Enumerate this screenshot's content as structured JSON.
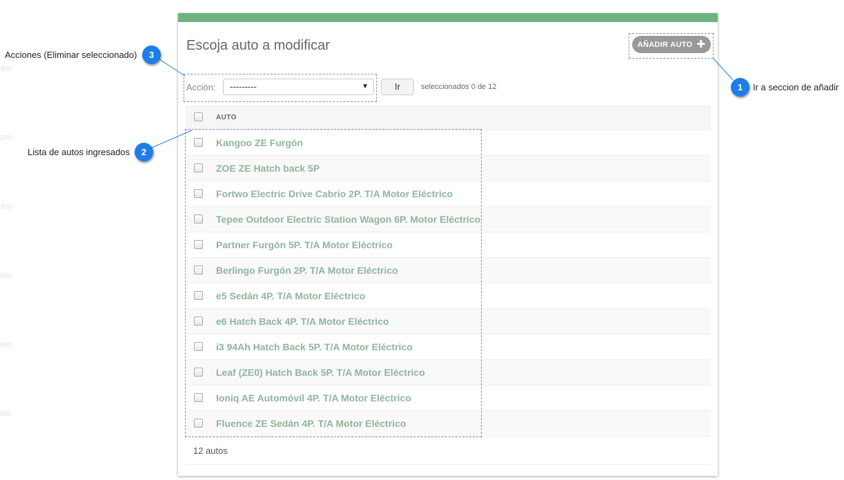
{
  "ruler": [
    "100",
    "200",
    "300",
    "400",
    "500",
    "600"
  ],
  "page": {
    "title": "Escoja auto a modificar",
    "add_button": "AÑADIR AUTO",
    "add_icon": "plus-icon"
  },
  "actions": {
    "label": "Acción:",
    "select_value": "---------",
    "go_button": "Ir",
    "selected_text": "seleccionados 0 de 12"
  },
  "table": {
    "column_header": "AUTO",
    "rows": [
      "Kangoo ZE Furgón",
      "ZOE ZE Hatch back 5P",
      "Fortwo Electric Drive Cabrio 2P. T/A Motor Eléctrico",
      "Tepee Outdoor Electric Station Wagon 6P. Motor Eléctrico",
      "Partner Furgón 5P. T/A Motor Eléctrico",
      "Berlingo Furgón 2P. T/A Motor Eléctrico",
      "e5 Sedán 4P. T/A Motor Eléctrico",
      "e6 Hatch Back 4P. T/A Motor Eléctrico",
      "i3 94Ah Hatch Back 5P. T/A Motor Eléctrico",
      "Leaf (ZE0) Hatch Back 5P. T/A Motor Eléctrico",
      "Ioniq AE Automóvil 4P. T/A Motor Eléctrico",
      "Fluence ZE Sedán 4P. T/A Motor Eléctrico"
    ],
    "total": "12 autos"
  },
  "annotations": [
    {
      "number": "1",
      "text": "Ir a seccion de añadir"
    },
    {
      "number": "2",
      "text": "Lista de autos ingresados"
    },
    {
      "number": "3",
      "text": "Acciones (Eliminar seleccionado)"
    }
  ],
  "colors": {
    "top_bar": "#6cb37f",
    "row_link": "#8fb59c",
    "badge": "#1e7ee8",
    "add_button": "#999999"
  }
}
